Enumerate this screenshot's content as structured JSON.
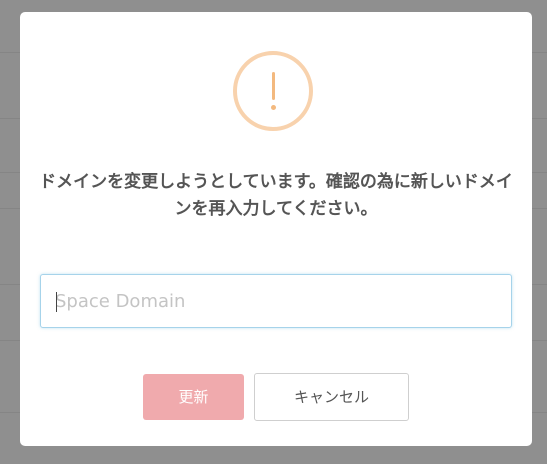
{
  "dialog": {
    "message": "ドメインを変更しようとしています。確認の為に新しいドメインを再入力してください。",
    "icon": "warning-exclamation-icon",
    "accent_color": "#f3b97f"
  },
  "input": {
    "placeholder": "Space Domain",
    "value": ""
  },
  "buttons": {
    "confirm_label": "更新",
    "confirm_color": "#f0aaad",
    "cancel_label": "キャンセル"
  }
}
